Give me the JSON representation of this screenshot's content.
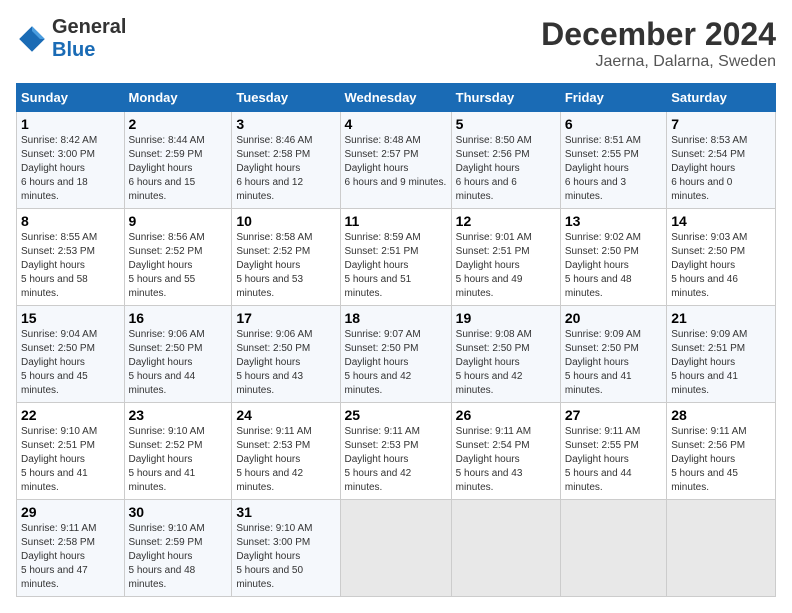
{
  "header": {
    "logo_line1": "General",
    "logo_line2": "Blue",
    "title": "December 2024",
    "subtitle": "Jaerna, Dalarna, Sweden"
  },
  "weekdays": [
    "Sunday",
    "Monday",
    "Tuesday",
    "Wednesday",
    "Thursday",
    "Friday",
    "Saturday"
  ],
  "weeks": [
    [
      {
        "day": "1",
        "sunrise": "8:42 AM",
        "sunset": "3:00 PM",
        "daylight": "6 hours and 18 minutes."
      },
      {
        "day": "2",
        "sunrise": "8:44 AM",
        "sunset": "2:59 PM",
        "daylight": "6 hours and 15 minutes."
      },
      {
        "day": "3",
        "sunrise": "8:46 AM",
        "sunset": "2:58 PM",
        "daylight": "6 hours and 12 minutes."
      },
      {
        "day": "4",
        "sunrise": "8:48 AM",
        "sunset": "2:57 PM",
        "daylight": "6 hours and 9 minutes."
      },
      {
        "day": "5",
        "sunrise": "8:50 AM",
        "sunset": "2:56 PM",
        "daylight": "6 hours and 6 minutes."
      },
      {
        "day": "6",
        "sunrise": "8:51 AM",
        "sunset": "2:55 PM",
        "daylight": "6 hours and 3 minutes."
      },
      {
        "day": "7",
        "sunrise": "8:53 AM",
        "sunset": "2:54 PM",
        "daylight": "6 hours and 0 minutes."
      }
    ],
    [
      {
        "day": "8",
        "sunrise": "8:55 AM",
        "sunset": "2:53 PM",
        "daylight": "5 hours and 58 minutes."
      },
      {
        "day": "9",
        "sunrise": "8:56 AM",
        "sunset": "2:52 PM",
        "daylight": "5 hours and 55 minutes."
      },
      {
        "day": "10",
        "sunrise": "8:58 AM",
        "sunset": "2:52 PM",
        "daylight": "5 hours and 53 minutes."
      },
      {
        "day": "11",
        "sunrise": "8:59 AM",
        "sunset": "2:51 PM",
        "daylight": "5 hours and 51 minutes."
      },
      {
        "day": "12",
        "sunrise": "9:01 AM",
        "sunset": "2:51 PM",
        "daylight": "5 hours and 49 minutes."
      },
      {
        "day": "13",
        "sunrise": "9:02 AM",
        "sunset": "2:50 PM",
        "daylight": "5 hours and 48 minutes."
      },
      {
        "day": "14",
        "sunrise": "9:03 AM",
        "sunset": "2:50 PM",
        "daylight": "5 hours and 46 minutes."
      }
    ],
    [
      {
        "day": "15",
        "sunrise": "9:04 AM",
        "sunset": "2:50 PM",
        "daylight": "5 hours and 45 minutes."
      },
      {
        "day": "16",
        "sunrise": "9:06 AM",
        "sunset": "2:50 PM",
        "daylight": "5 hours and 44 minutes."
      },
      {
        "day": "17",
        "sunrise": "9:06 AM",
        "sunset": "2:50 PM",
        "daylight": "5 hours and 43 minutes."
      },
      {
        "day": "18",
        "sunrise": "9:07 AM",
        "sunset": "2:50 PM",
        "daylight": "5 hours and 42 minutes."
      },
      {
        "day": "19",
        "sunrise": "9:08 AM",
        "sunset": "2:50 PM",
        "daylight": "5 hours and 42 minutes."
      },
      {
        "day": "20",
        "sunrise": "9:09 AM",
        "sunset": "2:50 PM",
        "daylight": "5 hours and 41 minutes."
      },
      {
        "day": "21",
        "sunrise": "9:09 AM",
        "sunset": "2:51 PM",
        "daylight": "5 hours and 41 minutes."
      }
    ],
    [
      {
        "day": "22",
        "sunrise": "9:10 AM",
        "sunset": "2:51 PM",
        "daylight": "5 hours and 41 minutes."
      },
      {
        "day": "23",
        "sunrise": "9:10 AM",
        "sunset": "2:52 PM",
        "daylight": "5 hours and 41 minutes."
      },
      {
        "day": "24",
        "sunrise": "9:11 AM",
        "sunset": "2:53 PM",
        "daylight": "5 hours and 42 minutes."
      },
      {
        "day": "25",
        "sunrise": "9:11 AM",
        "sunset": "2:53 PM",
        "daylight": "5 hours and 42 minutes."
      },
      {
        "day": "26",
        "sunrise": "9:11 AM",
        "sunset": "2:54 PM",
        "daylight": "5 hours and 43 minutes."
      },
      {
        "day": "27",
        "sunrise": "9:11 AM",
        "sunset": "2:55 PM",
        "daylight": "5 hours and 44 minutes."
      },
      {
        "day": "28",
        "sunrise": "9:11 AM",
        "sunset": "2:56 PM",
        "daylight": "5 hours and 45 minutes."
      }
    ],
    [
      {
        "day": "29",
        "sunrise": "9:11 AM",
        "sunset": "2:58 PM",
        "daylight": "5 hours and 47 minutes."
      },
      {
        "day": "30",
        "sunrise": "9:10 AM",
        "sunset": "2:59 PM",
        "daylight": "5 hours and 48 minutes."
      },
      {
        "day": "31",
        "sunrise": "9:10 AM",
        "sunset": "3:00 PM",
        "daylight": "5 hours and 50 minutes."
      },
      null,
      null,
      null,
      null
    ]
  ]
}
